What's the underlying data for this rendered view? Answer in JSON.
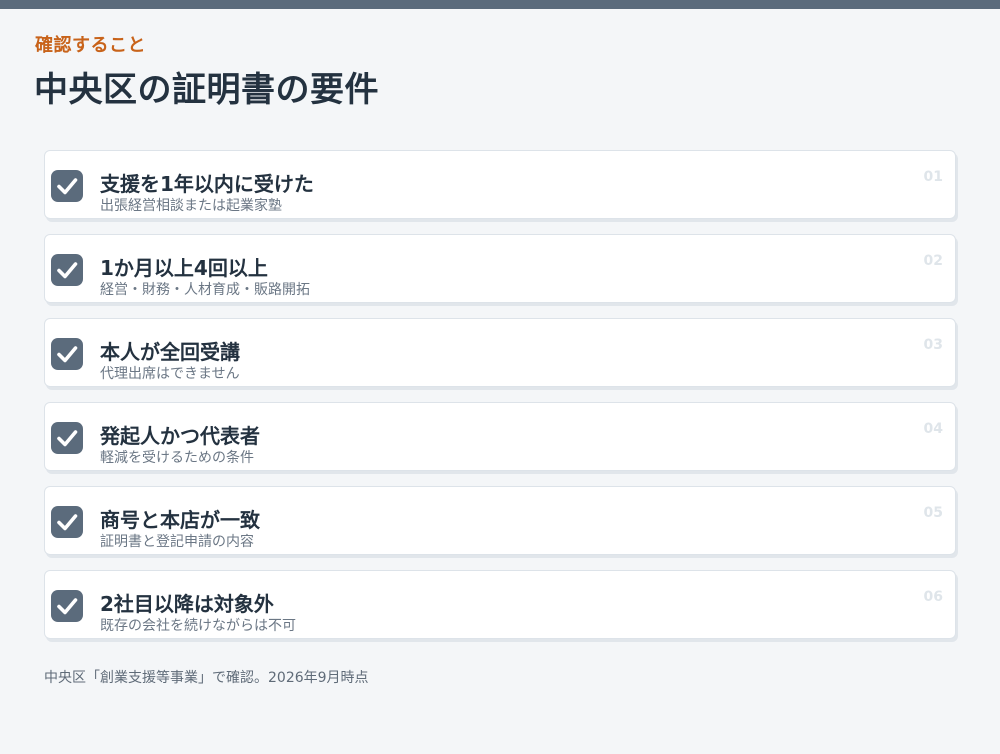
{
  "header": {
    "eyebrow": "確認すること",
    "title": "中央区の証明書の要件"
  },
  "items": [
    {
      "title": "支援を1年以内に受けた",
      "subtitle": "出張経営相談または起業家塾",
      "number": "01",
      "checked": true
    },
    {
      "title": "1か月以上4回以上",
      "subtitle": "経営・財務・人材育成・販路開拓",
      "number": "02",
      "checked": true
    },
    {
      "title": "本人が全回受講",
      "subtitle": "代理出席はできません",
      "number": "03",
      "checked": true
    },
    {
      "title": "発起人かつ代表者",
      "subtitle": "軽減を受けるための条件",
      "number": "04",
      "checked": true
    },
    {
      "title": "商号と本店が一致",
      "subtitle": "証明書と登記申請の内容",
      "number": "05",
      "checked": true
    },
    {
      "title": "2社目以降は対象外",
      "subtitle": "既存の会社を続けながらは不可",
      "number": "06",
      "checked": true
    }
  ],
  "footnote": "中央区「創業支援等事業」で確認。2026年9月時点",
  "colors": {
    "accent": "#c8631a",
    "top_bar": "#5b6b7c",
    "checkbox": "#5b6b7c",
    "title_text": "#243240"
  }
}
